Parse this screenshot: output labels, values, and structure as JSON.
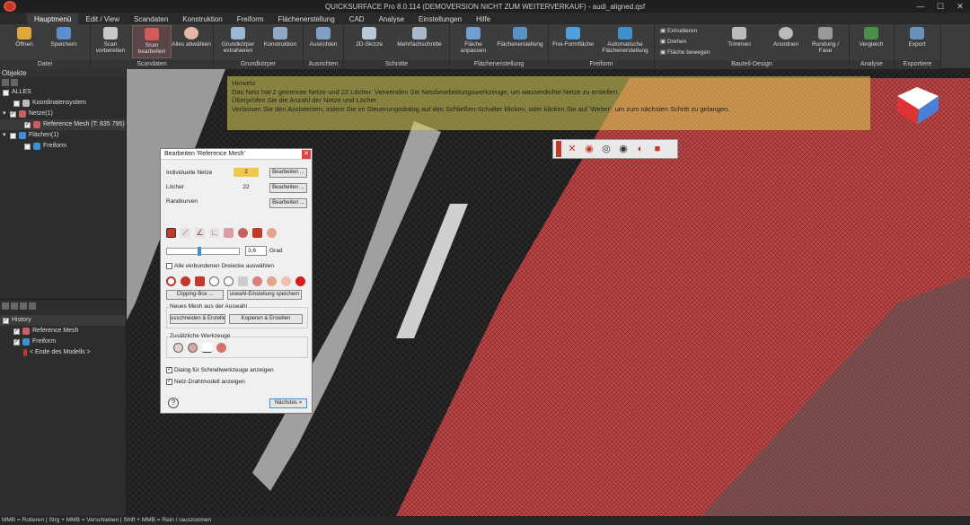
{
  "window": {
    "title": "QUICKSURFACE Pro 8.0.114 (DEMOVERSION NICHT ZUM WEITERVERKAUF) - audi_aligned.qsf",
    "min_icon": "minimize-icon",
    "max_icon": "maximize-icon",
    "close_icon": "close-icon"
  },
  "menu": {
    "tabs": [
      "Hauptmenü",
      "Edit / View",
      "Scandaten",
      "Konstruktion",
      "Freiform",
      "Flächenerstellung",
      "CAD",
      "Analyse",
      "Einstellungen",
      "Hilfe"
    ]
  },
  "ribbon": {
    "groups": [
      {
        "label": "Datei",
        "buttons": [
          "Öffnen",
          "Speichern"
        ]
      },
      {
        "label": "Scandaten",
        "buttons": [
          "Scan vorbereiten",
          "Scan bearbeiten",
          "Alles abwählen"
        ]
      },
      {
        "label": "Grundkörper",
        "buttons": [
          "Grundkörper extrahieren",
          "Konstruktion"
        ]
      },
      {
        "label": "Ausrichten",
        "buttons": [
          "Ausrichten"
        ]
      },
      {
        "label": "Schnitte",
        "buttons": [
          "2D-Skizze",
          "Mehrfachschnitte"
        ]
      },
      {
        "label": "Flächenerstellung",
        "buttons": [
          "Fläche anpassen",
          "Flächenerstellung"
        ]
      },
      {
        "label": "Freiform",
        "buttons": [
          "Frei-Formfläche",
          "Automatische Flächenerstellung"
        ]
      },
      {
        "label": "Bauteil-Design",
        "buttons": [
          "Extrudieren",
          "Drehen",
          "Fläche bewegen",
          "Trimmen",
          "Anordnen",
          "Rundung / Fase"
        ]
      },
      {
        "label": "Analyse",
        "buttons": [
          "Vergleich"
        ]
      },
      {
        "label": "Exportiere",
        "buttons": [
          "Export"
        ]
      }
    ]
  },
  "objects_panel": {
    "title": "Objekte",
    "items": [
      {
        "label": "ALLES",
        "level": 0
      },
      {
        "label": "Koordinatensystem",
        "level": 1
      },
      {
        "label": "Netze(1)",
        "level": 1
      },
      {
        "label": "Reference Mesh (T: 835 795)",
        "level": 2
      },
      {
        "label": "Flächen(1)",
        "level": 1
      },
      {
        "label": "Freiform",
        "level": 2
      }
    ]
  },
  "history_panel": {
    "title": "History",
    "items": [
      "Reference Mesh",
      "Freiform",
      "< Ende des Modells >"
    ]
  },
  "hint": {
    "title": "Hinweis",
    "lines": [
      "Das Netz hat 2 getrennte Netze und 22 Löcher. Verwenden Sie Netzbearbeitungswerkzeuge, um wasserdichte Netze zu erstellen.",
      "Überprüfen Sie die Anzahl der Netze und Löcher.",
      "Verlassen Sie den Assistenten, indem Sie im Steuerungsdialog auf den Schließen-Schalter klicken, oder klicken Sie auf 'Weiter', um zum nächsten Schritt zu gelangen."
    ]
  },
  "dialog": {
    "title": "Bearbeiten 'Reference Mesh'",
    "rows": [
      {
        "label": "Individuelle Netze",
        "value": "2",
        "button": "Bearbeiten ..."
      },
      {
        "label": "Löcher",
        "value": "22",
        "button": "Bearbeiten ..."
      },
      {
        "label": "Randkurven",
        "value": "",
        "button": "Bearbeiten ..."
      }
    ],
    "angle_value": "3,6",
    "angle_unit": "Grad",
    "select_connected": "Alle verbundenen Dreiecke auswählen",
    "clipping_button": "Clipping-Box ...",
    "save_selection_button": "uswahl-Einstellung speichern",
    "new_mesh_group": "Neues Mesh aus der Auswahl",
    "cut_button": "usschneiden & Erstelle",
    "copy_button": "Kopieren & Erstellen",
    "extra_tools_group": "Zusätzliche Werkzeuge",
    "quick_tools_label": "Dialog für Schnellwerkzeuge anzeigen",
    "wireframe_label": "Netz-Drahtmodell anzeigen",
    "help_icon": "help-icon",
    "next_button": "Nächstes >"
  },
  "statusbar": {
    "text": "MMB = Rotieren | Strg + MMB = Verschieben | Shift + MMB = Rein / rauszoomen"
  },
  "colors": {
    "accent": "#c0392b",
    "mesh_red": "#b84545",
    "hint_yellow": "#dcd25a"
  }
}
